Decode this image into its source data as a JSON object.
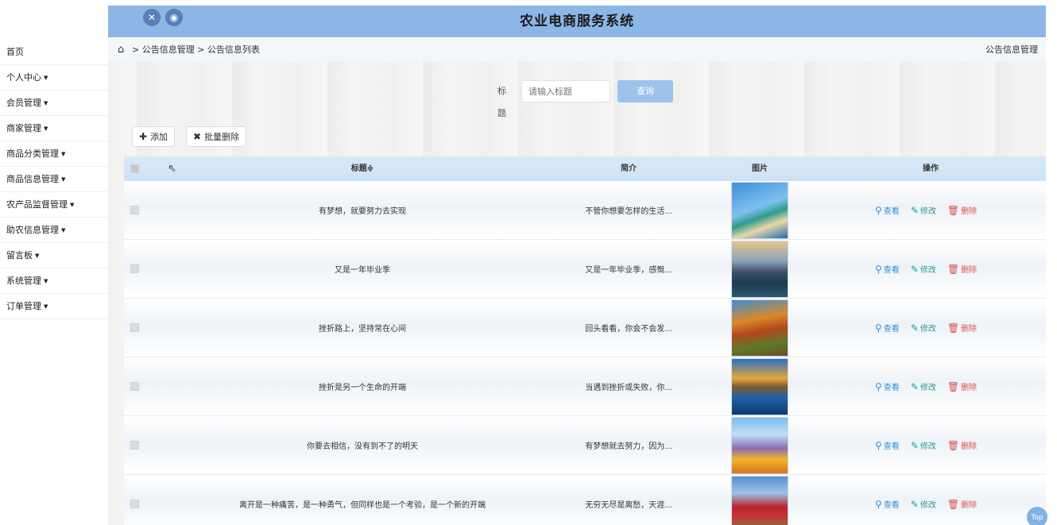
{
  "header": {
    "title": "农业电商服务系统",
    "icons": [
      "fullscreen-icon",
      "user-icon"
    ]
  },
  "sidebar": {
    "items": [
      {
        "label": "首页",
        "has_caret": false
      },
      {
        "label": "个人中心",
        "has_caret": true
      },
      {
        "label": "会员管理",
        "has_caret": true
      },
      {
        "label": "商家管理",
        "has_caret": true
      },
      {
        "label": "商品分类管理",
        "has_caret": true
      },
      {
        "label": "商品信息管理",
        "has_caret": true
      },
      {
        "label": "农产品监督管理",
        "has_caret": true
      },
      {
        "label": "助农信息管理",
        "has_caret": true
      },
      {
        "label": "留言板",
        "has_caret": true
      },
      {
        "label": "系统管理",
        "has_caret": true
      },
      {
        "label": "订单管理",
        "has_caret": true
      }
    ]
  },
  "breadcrumb": {
    "path": "> 公告信息管理 > 公告信息列表",
    "right": "公告信息管理"
  },
  "search": {
    "label": "标题",
    "placeholder": "请输入标题",
    "button": "查询"
  },
  "toolbar": {
    "add": "添加",
    "batch_delete": "批量删除"
  },
  "table": {
    "headers": {
      "title": "标题≑",
      "brief": "简介",
      "image": "图片",
      "ops": "操作"
    },
    "ops": {
      "view": "查看",
      "edit": "修改",
      "delete": "删除"
    },
    "rows": [
      {
        "title": "有梦想，就要努力去实现",
        "brief": "不管你想要怎样的生活...",
        "image": "beach-palm-image"
      },
      {
        "title": "又是一年毕业季",
        "brief": "又是一年毕业季，感慨...",
        "image": "lake-mountain-image"
      },
      {
        "title": "挫折路上，坚持常在心间",
        "brief": "回头看看，你会不会发...",
        "image": "autumn-road-image"
      },
      {
        "title": "挫折是另一个生命的开端",
        "brief": "当遇到挫折或失败，你...",
        "image": "mountain-reflection-image"
      },
      {
        "title": "你要去相信，没有到不了的明天",
        "brief": "有梦想就去努力，因为...",
        "image": "flower-field-image"
      },
      {
        "title": "离开是一种痛苦，是一种勇气，但同样也是一个考验，是一个新的开端",
        "brief": "无穷无尽是离愁，天涯...",
        "image": "red-tree-image"
      }
    ]
  },
  "top_button": "Top",
  "colors": {
    "header_bg": "#8cb6e6",
    "query_button": "#9cc3ec",
    "view": "#3a8ed6",
    "edit": "#2c9a8f",
    "delete": "#d9534f"
  }
}
